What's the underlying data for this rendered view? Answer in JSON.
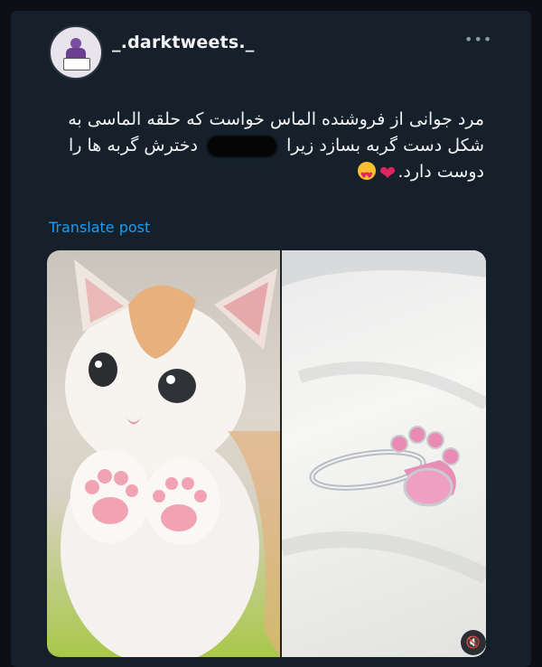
{
  "post": {
    "username": "_.darktweets._",
    "more_label": "•••",
    "text_line1": "مرد جوانی از فروشنده الماس خواست که حلقه الماسی به",
    "text_line2a": "شکل دست گربه بسازد زیرا",
    "text_line2b": "دخترش گربه ها را",
    "text_line3": "دوست دارد.",
    "translate_label": "Translate post"
  },
  "media": {
    "left_image": "kitten-showing-pink-paws",
    "right_image": "silver-ring-with-pink-paw-gems",
    "mute_icon": "mute-icon"
  },
  "colors": {
    "background": "#15202b",
    "link": "#1d9bf0",
    "text": "#e7e9ea"
  }
}
